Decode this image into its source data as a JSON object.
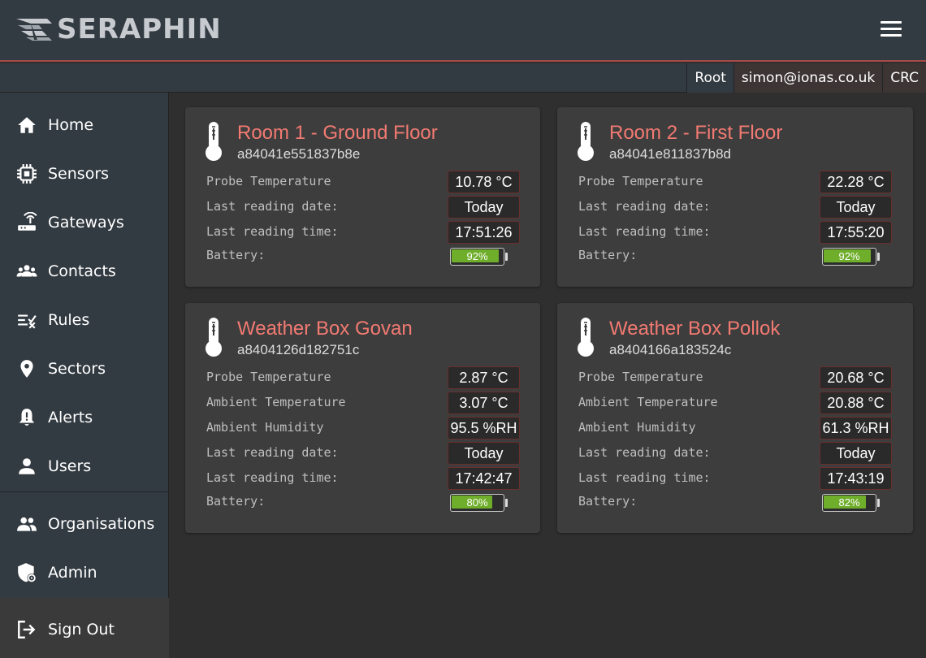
{
  "brand": {
    "name": "SERAPHIN"
  },
  "header": {
    "menu_icon": "hamburger-menu-icon"
  },
  "userbar": {
    "role": "Root",
    "email": "simon@ionas.co.uk",
    "org": "CRC"
  },
  "sidebar": {
    "items": [
      {
        "label": "Home",
        "icon": "home-icon"
      },
      {
        "label": "Sensors",
        "icon": "chip-icon"
      },
      {
        "label": "Gateways",
        "icon": "router-icon"
      },
      {
        "label": "Contacts",
        "icon": "group-icon"
      },
      {
        "label": "Rules",
        "icon": "rules-icon"
      },
      {
        "label": "Sectors",
        "icon": "map-pin-icon"
      },
      {
        "label": "Alerts",
        "icon": "bell-alert-icon"
      },
      {
        "label": "Users",
        "icon": "user-icon"
      },
      {
        "label": "Organisations",
        "icon": "people-icon"
      },
      {
        "label": "Admin",
        "icon": "admin-shield-icon"
      },
      {
        "label": "Sign Out",
        "icon": "sign-out-icon"
      }
    ]
  },
  "colors": {
    "accent": "#f27a72",
    "battery_fill": "#6fae2b",
    "header_bg": "#333b42"
  },
  "cards": [
    {
      "title": "Room 1 - Ground Floor",
      "device_id": "a84041e551837b8e",
      "rows": [
        {
          "label": "Probe Temperature",
          "value": "10.78 °C"
        },
        {
          "label": "Last reading date:",
          "value": "Today"
        },
        {
          "label": "Last reading time:",
          "value": "17:51:26"
        }
      ],
      "battery_label": "Battery:",
      "battery_pct": 92,
      "battery_text": "92%"
    },
    {
      "title": "Room 2 - First Floor",
      "device_id": "a84041e811837b8d",
      "rows": [
        {
          "label": "Probe Temperature",
          "value": "22.28 °C"
        },
        {
          "label": "Last reading date:",
          "value": "Today"
        },
        {
          "label": "Last reading time:",
          "value": "17:55:20"
        }
      ],
      "battery_label": "Battery:",
      "battery_pct": 92,
      "battery_text": "92%"
    },
    {
      "title": "Weather Box Govan",
      "device_id": "a8404126d182751c",
      "rows": [
        {
          "label": "Probe Temperature",
          "value": "2.87 °C"
        },
        {
          "label": "Ambient Temperature",
          "value": "3.07 °C"
        },
        {
          "label": "Ambient Humidity",
          "value": "95.5 %RH"
        },
        {
          "label": "Last reading date:",
          "value": "Today"
        },
        {
          "label": "Last reading time:",
          "value": "17:42:47"
        }
      ],
      "battery_label": "Battery:",
      "battery_pct": 80,
      "battery_text": "80%"
    },
    {
      "title": "Weather Box Pollok",
      "device_id": "a8404166a183524c",
      "rows": [
        {
          "label": "Probe Temperature",
          "value": "20.68 °C"
        },
        {
          "label": "Ambient Temperature",
          "value": "20.88 °C"
        },
        {
          "label": "Ambient Humidity",
          "value": "61.3 %RH"
        },
        {
          "label": "Last reading date:",
          "value": "Today"
        },
        {
          "label": "Last reading time:",
          "value": "17:43:19"
        }
      ],
      "battery_label": "Battery:",
      "battery_pct": 82,
      "battery_text": "82%"
    }
  ]
}
